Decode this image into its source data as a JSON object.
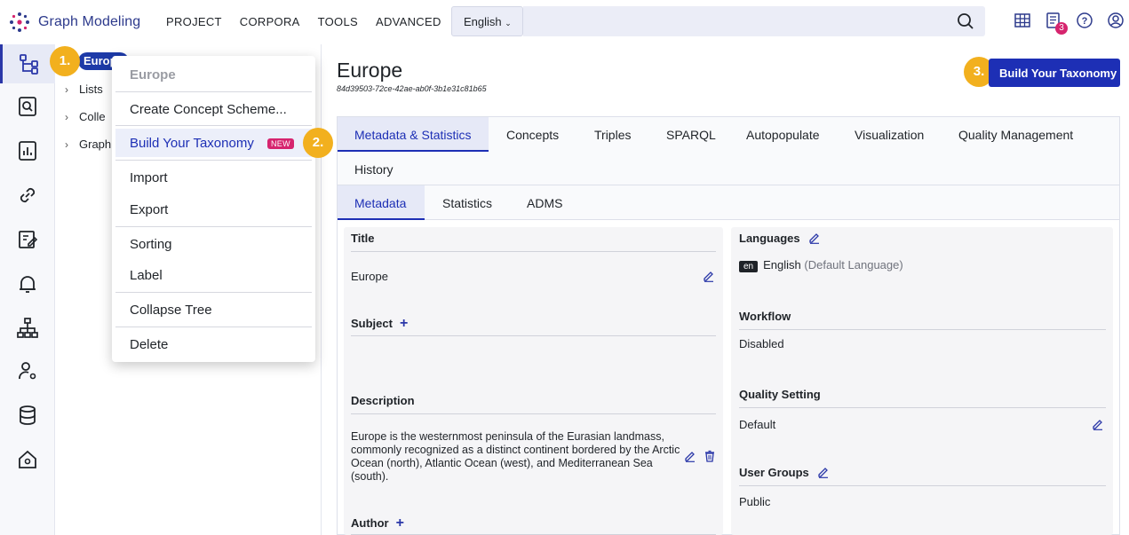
{
  "app": {
    "name": "Graph Modeling"
  },
  "topnav": [
    "PROJECT",
    "CORPORA",
    "TOOLS",
    "ADVANCED"
  ],
  "lang_select": {
    "value": "English"
  },
  "notifications_count": "3",
  "tree": {
    "selected": "Europe",
    "items": [
      "Lists",
      "Colle",
      "Graph"
    ]
  },
  "steps": [
    "1.",
    "2.",
    "3."
  ],
  "context_menu": {
    "header": "Europe",
    "items": [
      "Create Concept Scheme...",
      "Build Your Taxonomy",
      "Import",
      "Export",
      "Sorting",
      "Label",
      "Collapse Tree",
      "Delete"
    ],
    "new_badge": "NEW"
  },
  "page": {
    "title": "Europe",
    "id": "84d39503-72ce-42ae-ab0f-3b1e31c81b65",
    "build_button": "Build Your Taxonomy"
  },
  "tabs": [
    "Metadata & Statistics",
    "Concepts",
    "Triples",
    "SPARQL",
    "Autopopulate",
    "Visualization",
    "Quality Management",
    "History"
  ],
  "subtabs": [
    "Metadata",
    "Statistics",
    "ADMS"
  ],
  "metadata": {
    "title_label": "Title",
    "title_value": "Europe",
    "subject_label": "Subject",
    "description_label": "Description",
    "description_value": "Europe is the westernmost peninsula of the Eurasian landmass, commonly recognized as a distinct continent bordered by the Arctic Ocean (north), Atlantic Ocean (west), and Mediterranean Sea (south).",
    "author_label": "Author",
    "languages_label": "Languages",
    "language_code": "en",
    "language_name": "English",
    "language_note": "(Default Language)",
    "workflow_label": "Workflow",
    "workflow_value": "Disabled",
    "quality_label": "Quality Setting",
    "quality_value": "Default",
    "groups_label": "User Groups",
    "groups_value": "Public"
  },
  "colors": {
    "accent": "#1d2fb5",
    "step": "#f2b01e",
    "badge": "#d6246e"
  }
}
